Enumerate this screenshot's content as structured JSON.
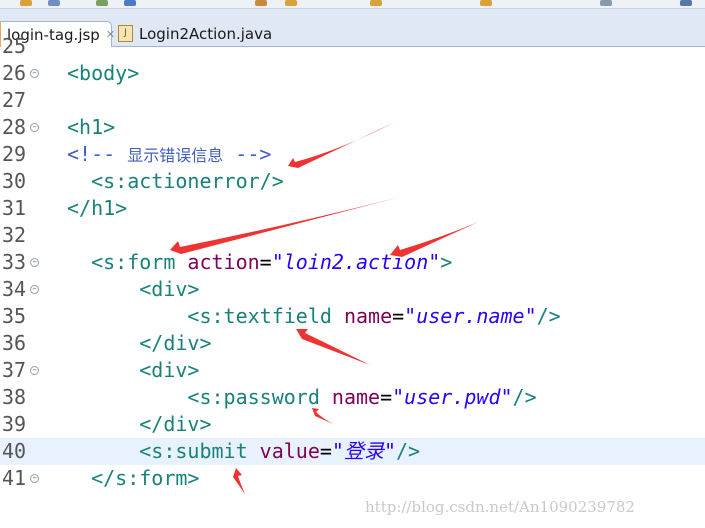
{
  "tabs": [
    {
      "label": "login-tag.jsp",
      "active": true
    },
    {
      "label": "Login2Action.java",
      "active": false
    }
  ],
  "lines": [
    {
      "num": "25",
      "parts": []
    },
    {
      "num": "26",
      "fold": true,
      "parts": [
        {
          "t": "tag",
          "s": "<body>"
        }
      ]
    },
    {
      "num": "27",
      "parts": []
    },
    {
      "num": "28",
      "fold": true,
      "parts": [
        {
          "t": "tag",
          "s": "<h1>"
        }
      ]
    },
    {
      "num": "29",
      "parts": [
        {
          "t": "cmt",
          "s": "<!-- "
        },
        {
          "t": "cmt-cn",
          "s": "显示错误信息"
        },
        {
          "t": "cmt",
          "s": " -->"
        }
      ]
    },
    {
      "num": "30",
      "parts": [
        {
          "t": "tag",
          "s": "  <s:actionerror/>"
        }
      ]
    },
    {
      "num": "31",
      "parts": [
        {
          "t": "tag",
          "s": "</h1>"
        }
      ]
    },
    {
      "num": "32",
      "parts": []
    },
    {
      "num": "33",
      "fold": true,
      "parts": [
        {
          "t": "tag",
          "s": "  <s:form "
        },
        {
          "t": "attr",
          "s": "action"
        },
        {
          "t": "eq",
          "s": "="
        },
        {
          "t": "str",
          "s": "\"loin2.action\""
        },
        {
          "t": "tag",
          "s": ">"
        }
      ]
    },
    {
      "num": "34",
      "fold": true,
      "parts": [
        {
          "t": "tag",
          "s": "      <div>"
        }
      ]
    },
    {
      "num": "35",
      "parts": [
        {
          "t": "tag",
          "s": "          <s:textfield "
        },
        {
          "t": "attr",
          "s": "name"
        },
        {
          "t": "eq",
          "s": "="
        },
        {
          "t": "str",
          "s": "\"user.name\""
        },
        {
          "t": "tag",
          "s": "/>"
        }
      ]
    },
    {
      "num": "36",
      "parts": [
        {
          "t": "tag",
          "s": "      </div>"
        }
      ]
    },
    {
      "num": "37",
      "fold": true,
      "parts": [
        {
          "t": "tag",
          "s": "      <div>"
        }
      ]
    },
    {
      "num": "38",
      "parts": [
        {
          "t": "tag",
          "s": "          <s:password "
        },
        {
          "t": "attr",
          "s": "name"
        },
        {
          "t": "eq",
          "s": "="
        },
        {
          "t": "str",
          "s": "\"user.pwd\""
        },
        {
          "t": "tag",
          "s": "/>"
        }
      ]
    },
    {
      "num": "39",
      "parts": [
        {
          "t": "tag",
          "s": "      </div>"
        }
      ]
    },
    {
      "num": "40",
      "current": true,
      "parts": [
        {
          "t": "tag",
          "s": "      <s:submit "
        },
        {
          "t": "attr",
          "s": "value"
        },
        {
          "t": "eq",
          "s": "="
        },
        {
          "t": "str",
          "s": "\"登录\""
        },
        {
          "t": "tag",
          "s": "/>"
        }
      ]
    },
    {
      "num": "41",
      "fold": true,
      "parts": [
        {
          "t": "tag",
          "s": "  </s:form>"
        }
      ]
    }
  ],
  "watermark": "http://blog.csdn.net/An1090239782",
  "colors": {
    "tag": "#17817a",
    "attr": "#7f0055",
    "string": "#2a00ff",
    "comment": "#3f5fbf",
    "arrow": "#ee3333",
    "current_line": "#e8f2fe"
  }
}
